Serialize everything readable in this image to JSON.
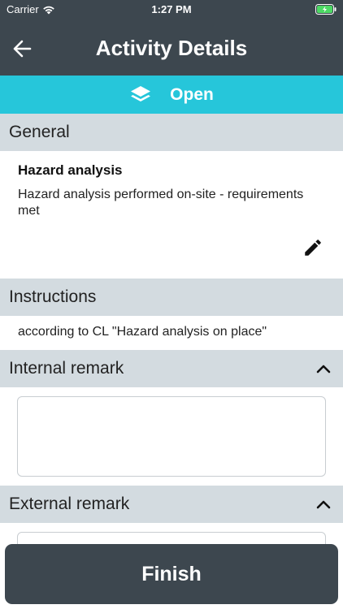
{
  "status_bar": {
    "carrier": "Carrier",
    "time": "1:27 PM"
  },
  "navbar": {
    "title": "Activity Details",
    "back_icon": "arrow-left-icon"
  },
  "activity_status": {
    "label": "Open",
    "icon": "layers-icon",
    "color": "#26c6da"
  },
  "sections": {
    "general": {
      "title": "General",
      "activity_name": "Hazard analysis",
      "description": "Hazard analysis performed on-site - requirements met",
      "edit_icon": "pencil-icon"
    },
    "instructions": {
      "title": "Instructions",
      "text": "according to CL \"Hazard analysis on place\""
    },
    "internal_remark": {
      "title": "Internal remark",
      "value": ""
    },
    "external_remark": {
      "title": "External remark",
      "value": ""
    }
  },
  "finish_button": {
    "label": "Finish"
  },
  "colors": {
    "header_bg": "#3d474f",
    "section_bg": "#d3dbe0",
    "accent": "#26c6da",
    "battery": "#4cd964"
  }
}
